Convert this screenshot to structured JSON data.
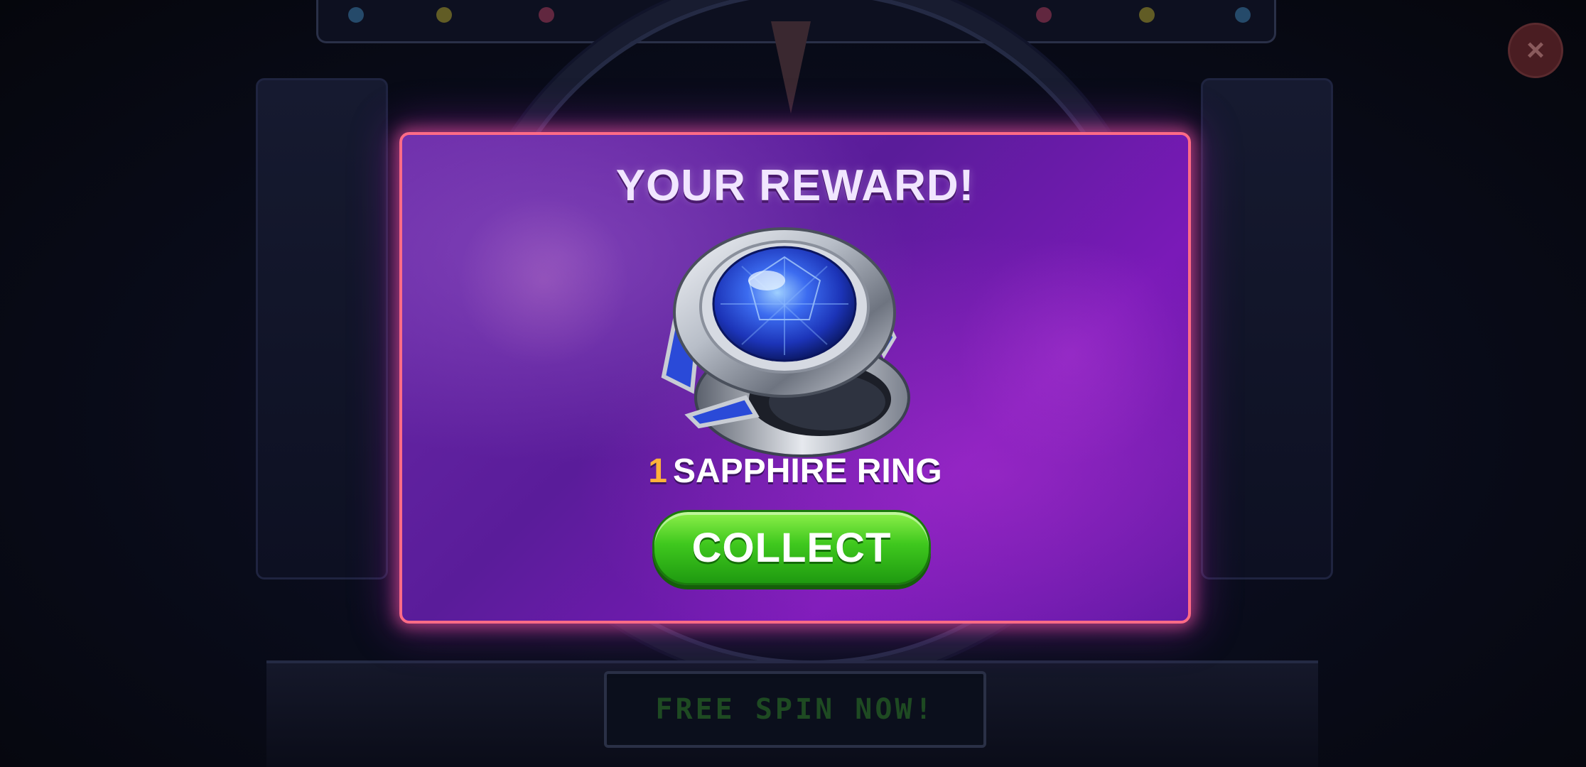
{
  "background": {
    "free_spin_label": "FREE SPIN NOW!",
    "close_icon": "close-icon"
  },
  "dialog": {
    "title": "YOUR REWARD!",
    "reward": {
      "quantity": "1",
      "name": "SAPPHIRE RING",
      "icon": "sapphire-ring-icon"
    },
    "collect_label": "COLLECT"
  },
  "colors": {
    "dialog_border": "#ff6b86",
    "dialog_fill": "#6a2aa8",
    "collect_green": "#3fc81e",
    "quantity_orange": "#ffb23a"
  }
}
